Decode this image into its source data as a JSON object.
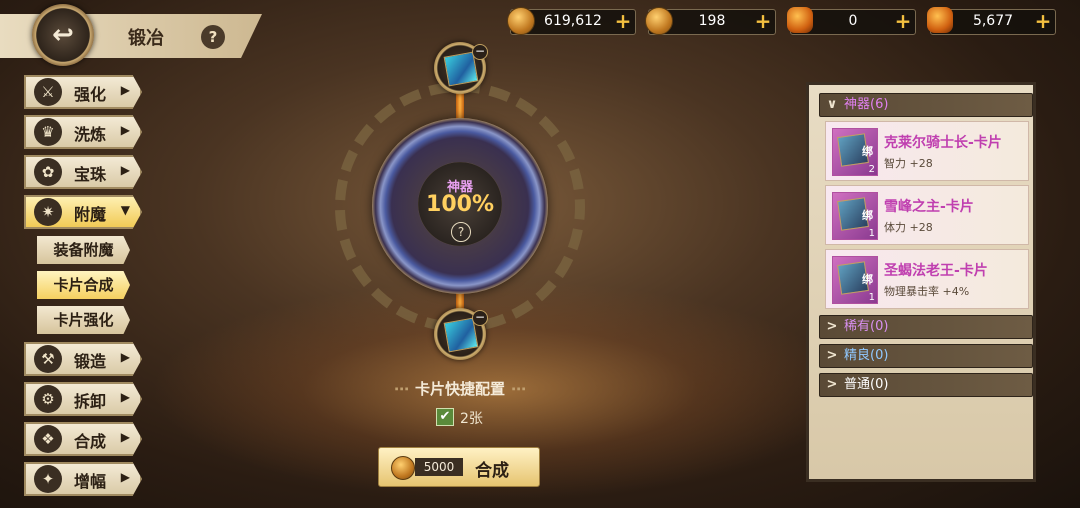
{
  "header": {
    "title": "锻冶",
    "help": "?",
    "back_icon": "↩"
  },
  "resources": [
    {
      "icon": "gold-coin-lock-icon",
      "value": "619,612",
      "plus": "+"
    },
    {
      "icon": "gold-coin-icon",
      "value": "198",
      "plus": "+"
    },
    {
      "icon": "amber-crystal-lock-icon",
      "value": "0",
      "plus": "+"
    },
    {
      "icon": "amber-crystal-icon",
      "value": "5,677",
      "plus": "+"
    }
  ],
  "menu": {
    "items": [
      {
        "label": "强化",
        "arrow": "▶"
      },
      {
        "label": "洗炼",
        "arrow": "▶"
      },
      {
        "label": "宝珠",
        "arrow": "▶"
      },
      {
        "label": "附魔",
        "arrow": "▼"
      },
      {
        "label": "锻造",
        "arrow": "▶"
      },
      {
        "label": "拆卸",
        "arrow": "▶"
      },
      {
        "label": "合成",
        "arrow": "▶"
      },
      {
        "label": "增幅",
        "arrow": "▶"
      }
    ],
    "sub_items": [
      {
        "label": "装备附魔"
      },
      {
        "label": "卡片合成"
      },
      {
        "label": "卡片强化"
      }
    ]
  },
  "center": {
    "rate_label": "神器",
    "rate_value": "100%",
    "rate_help": "?",
    "quick_config": "卡片快捷配置",
    "checkbox_label": "2张",
    "checkbox_mark": "✔",
    "cost": "5000",
    "synth_label": "合成"
  },
  "panel": {
    "categories": [
      {
        "label": "神器(6)",
        "color": "#e080f0",
        "chev": "∨"
      },
      {
        "label": "稀有(0)",
        "color": "#d890f0",
        "chev": ">"
      },
      {
        "label": "精良(0)",
        "color": "#90c8ff",
        "chev": ">"
      },
      {
        "label": "普通(0)",
        "color": "#ffffff",
        "chev": ">"
      }
    ],
    "items": [
      {
        "name": "克莱尔骑士长-卡片",
        "stat": "智力 +28",
        "bind": "绑",
        "count": "2"
      },
      {
        "name": "雪峰之主-卡片",
        "stat": "体力 +28",
        "bind": "绑",
        "count": "1"
      },
      {
        "name": "圣蝎法老王-卡片",
        "stat": "物理暴击率 +4%",
        "bind": "绑",
        "count": "1"
      }
    ]
  }
}
